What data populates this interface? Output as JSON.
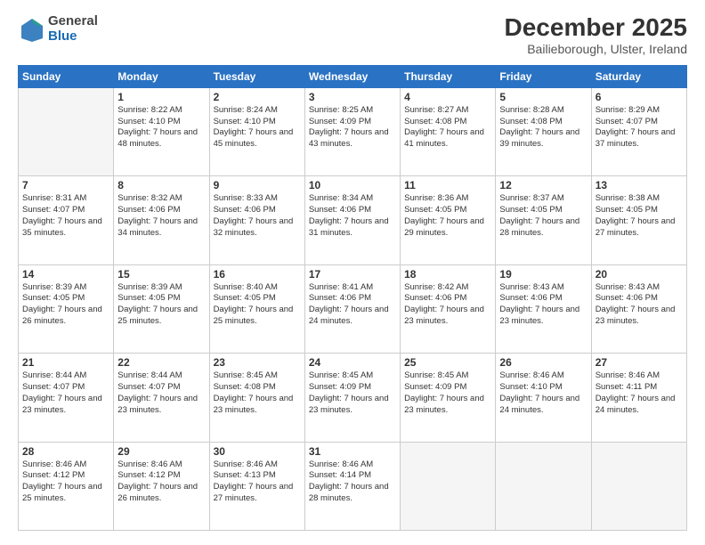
{
  "header": {
    "logo_general": "General",
    "logo_blue": "Blue",
    "title": "December 2025",
    "subtitle": "Bailieborough, Ulster, Ireland"
  },
  "calendar": {
    "days_of_week": [
      "Sunday",
      "Monday",
      "Tuesday",
      "Wednesday",
      "Thursday",
      "Friday",
      "Saturday"
    ],
    "weeks": [
      [
        {
          "day": "",
          "empty": true
        },
        {
          "day": "1",
          "sunrise": "Sunrise: 8:22 AM",
          "sunset": "Sunset: 4:10 PM",
          "daylight": "Daylight: 7 hours and 48 minutes."
        },
        {
          "day": "2",
          "sunrise": "Sunrise: 8:24 AM",
          "sunset": "Sunset: 4:10 PM",
          "daylight": "Daylight: 7 hours and 45 minutes."
        },
        {
          "day": "3",
          "sunrise": "Sunrise: 8:25 AM",
          "sunset": "Sunset: 4:09 PM",
          "daylight": "Daylight: 7 hours and 43 minutes."
        },
        {
          "day": "4",
          "sunrise": "Sunrise: 8:27 AM",
          "sunset": "Sunset: 4:08 PM",
          "daylight": "Daylight: 7 hours and 41 minutes."
        },
        {
          "day": "5",
          "sunrise": "Sunrise: 8:28 AM",
          "sunset": "Sunset: 4:08 PM",
          "daylight": "Daylight: 7 hours and 39 minutes."
        },
        {
          "day": "6",
          "sunrise": "Sunrise: 8:29 AM",
          "sunset": "Sunset: 4:07 PM",
          "daylight": "Daylight: 7 hours and 37 minutes."
        }
      ],
      [
        {
          "day": "7",
          "sunrise": "Sunrise: 8:31 AM",
          "sunset": "Sunset: 4:07 PM",
          "daylight": "Daylight: 7 hours and 35 minutes."
        },
        {
          "day": "8",
          "sunrise": "Sunrise: 8:32 AM",
          "sunset": "Sunset: 4:06 PM",
          "daylight": "Daylight: 7 hours and 34 minutes."
        },
        {
          "day": "9",
          "sunrise": "Sunrise: 8:33 AM",
          "sunset": "Sunset: 4:06 PM",
          "daylight": "Daylight: 7 hours and 32 minutes."
        },
        {
          "day": "10",
          "sunrise": "Sunrise: 8:34 AM",
          "sunset": "Sunset: 4:06 PM",
          "daylight": "Daylight: 7 hours and 31 minutes."
        },
        {
          "day": "11",
          "sunrise": "Sunrise: 8:36 AM",
          "sunset": "Sunset: 4:05 PM",
          "daylight": "Daylight: 7 hours and 29 minutes."
        },
        {
          "day": "12",
          "sunrise": "Sunrise: 8:37 AM",
          "sunset": "Sunset: 4:05 PM",
          "daylight": "Daylight: 7 hours and 28 minutes."
        },
        {
          "day": "13",
          "sunrise": "Sunrise: 8:38 AM",
          "sunset": "Sunset: 4:05 PM",
          "daylight": "Daylight: 7 hours and 27 minutes."
        }
      ],
      [
        {
          "day": "14",
          "sunrise": "Sunrise: 8:39 AM",
          "sunset": "Sunset: 4:05 PM",
          "daylight": "Daylight: 7 hours and 26 minutes."
        },
        {
          "day": "15",
          "sunrise": "Sunrise: 8:39 AM",
          "sunset": "Sunset: 4:05 PM",
          "daylight": "Daylight: 7 hours and 25 minutes."
        },
        {
          "day": "16",
          "sunrise": "Sunrise: 8:40 AM",
          "sunset": "Sunset: 4:05 PM",
          "daylight": "Daylight: 7 hours and 25 minutes."
        },
        {
          "day": "17",
          "sunrise": "Sunrise: 8:41 AM",
          "sunset": "Sunset: 4:06 PM",
          "daylight": "Daylight: 7 hours and 24 minutes."
        },
        {
          "day": "18",
          "sunrise": "Sunrise: 8:42 AM",
          "sunset": "Sunset: 4:06 PM",
          "daylight": "Daylight: 7 hours and 23 minutes."
        },
        {
          "day": "19",
          "sunrise": "Sunrise: 8:43 AM",
          "sunset": "Sunset: 4:06 PM",
          "daylight": "Daylight: 7 hours and 23 minutes."
        },
        {
          "day": "20",
          "sunrise": "Sunrise: 8:43 AM",
          "sunset": "Sunset: 4:06 PM",
          "daylight": "Daylight: 7 hours and 23 minutes."
        }
      ],
      [
        {
          "day": "21",
          "sunrise": "Sunrise: 8:44 AM",
          "sunset": "Sunset: 4:07 PM",
          "daylight": "Daylight: 7 hours and 23 minutes."
        },
        {
          "day": "22",
          "sunrise": "Sunrise: 8:44 AM",
          "sunset": "Sunset: 4:07 PM",
          "daylight": "Daylight: 7 hours and 23 minutes."
        },
        {
          "day": "23",
          "sunrise": "Sunrise: 8:45 AM",
          "sunset": "Sunset: 4:08 PM",
          "daylight": "Daylight: 7 hours and 23 minutes."
        },
        {
          "day": "24",
          "sunrise": "Sunrise: 8:45 AM",
          "sunset": "Sunset: 4:09 PM",
          "daylight": "Daylight: 7 hours and 23 minutes."
        },
        {
          "day": "25",
          "sunrise": "Sunrise: 8:45 AM",
          "sunset": "Sunset: 4:09 PM",
          "daylight": "Daylight: 7 hours and 23 minutes."
        },
        {
          "day": "26",
          "sunrise": "Sunrise: 8:46 AM",
          "sunset": "Sunset: 4:10 PM",
          "daylight": "Daylight: 7 hours and 24 minutes."
        },
        {
          "day": "27",
          "sunrise": "Sunrise: 8:46 AM",
          "sunset": "Sunset: 4:11 PM",
          "daylight": "Daylight: 7 hours and 24 minutes."
        }
      ],
      [
        {
          "day": "28",
          "sunrise": "Sunrise: 8:46 AM",
          "sunset": "Sunset: 4:12 PM",
          "daylight": "Daylight: 7 hours and 25 minutes."
        },
        {
          "day": "29",
          "sunrise": "Sunrise: 8:46 AM",
          "sunset": "Sunset: 4:12 PM",
          "daylight": "Daylight: 7 hours and 26 minutes."
        },
        {
          "day": "30",
          "sunrise": "Sunrise: 8:46 AM",
          "sunset": "Sunset: 4:13 PM",
          "daylight": "Daylight: 7 hours and 27 minutes."
        },
        {
          "day": "31",
          "sunrise": "Sunrise: 8:46 AM",
          "sunset": "Sunset: 4:14 PM",
          "daylight": "Daylight: 7 hours and 28 minutes."
        },
        {
          "day": "",
          "empty": true
        },
        {
          "day": "",
          "empty": true
        },
        {
          "day": "",
          "empty": true
        }
      ]
    ]
  }
}
